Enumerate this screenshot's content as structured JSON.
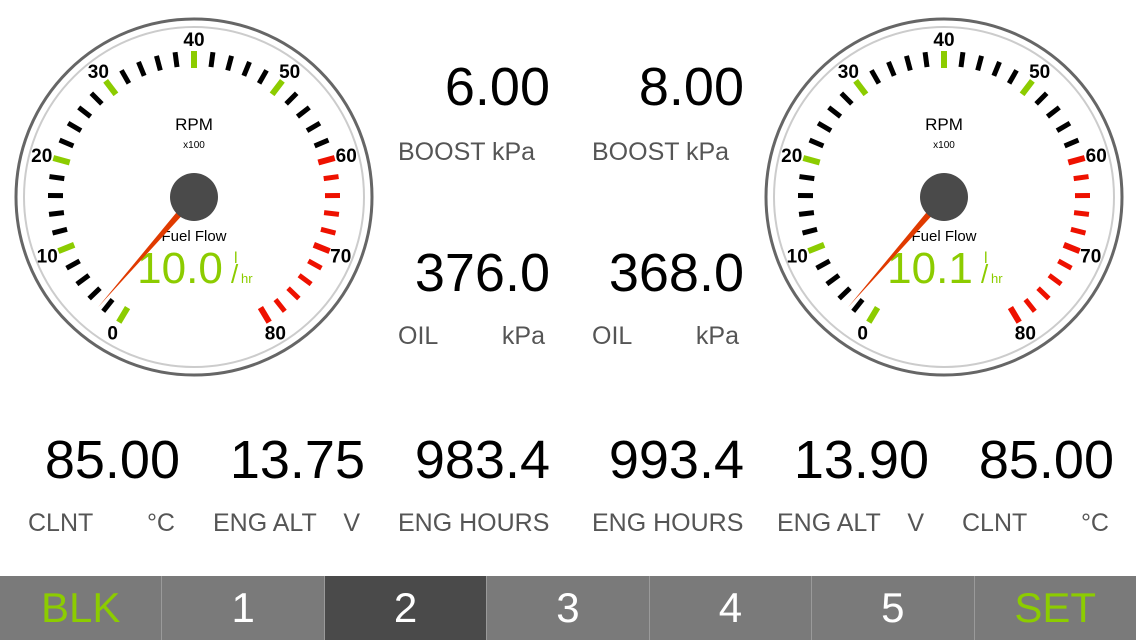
{
  "colors": {
    "accent_green": "#8ccc00",
    "danger_red": "#ee1100",
    "needle": "#e03a00",
    "hub": "#4a4a4a",
    "nav_bg": "#7a7a7a",
    "nav_active": "#4a4a4a"
  },
  "gauges": [
    {
      "title": "RPM",
      "multiplier": "x100",
      "scale_labels": [
        "0",
        "10",
        "20",
        "30",
        "40",
        "50",
        "60",
        "70",
        "80"
      ],
      "rpm_value": 2.7,
      "fuel_label": "Fuel Flow",
      "fuel_value": "10.0",
      "fuel_unit_num": "l",
      "fuel_unit_den": "hr"
    },
    {
      "title": "RPM",
      "multiplier": "x100",
      "scale_labels": [
        "0",
        "10",
        "20",
        "30",
        "40",
        "50",
        "60",
        "70",
        "80"
      ],
      "rpm_value": 2.7,
      "fuel_label": "Fuel Flow",
      "fuel_value": "10.1",
      "fuel_unit_num": "l",
      "fuel_unit_den": "hr"
    }
  ],
  "center": {
    "boost_left": {
      "value": "6.00",
      "label": "BOOST kPa"
    },
    "boost_right": {
      "value": "8.00",
      "label": "BOOST kPa"
    },
    "oil_left": {
      "value": "376.0",
      "label": "OIL",
      "unit": "kPa"
    },
    "oil_right": {
      "value": "368.0",
      "label": "OIL",
      "unit": "kPa"
    }
  },
  "bottom": [
    {
      "value": "85.00",
      "label": "CLNT",
      "unit": "°C"
    },
    {
      "value": "13.75",
      "label": "ENG ALT",
      "unit": "V"
    },
    {
      "value": "983.4",
      "label": "ENG HOURS",
      "unit": ""
    },
    {
      "value": "993.4",
      "label": "ENG HOURS",
      "unit": ""
    },
    {
      "value": "13.90",
      "label": "ENG ALT",
      "unit": "V"
    },
    {
      "value": "85.00",
      "label": "CLNT",
      "unit": "°C"
    }
  ],
  "nav": [
    {
      "label": "BLK",
      "accent": true,
      "active": false
    },
    {
      "label": "1",
      "accent": false,
      "active": false
    },
    {
      "label": "2",
      "accent": false,
      "active": true
    },
    {
      "label": "3",
      "accent": false,
      "active": false
    },
    {
      "label": "4",
      "accent": false,
      "active": false
    },
    {
      "label": "5",
      "accent": false,
      "active": false
    },
    {
      "label": "SET",
      "accent": true,
      "active": false
    }
  ]
}
